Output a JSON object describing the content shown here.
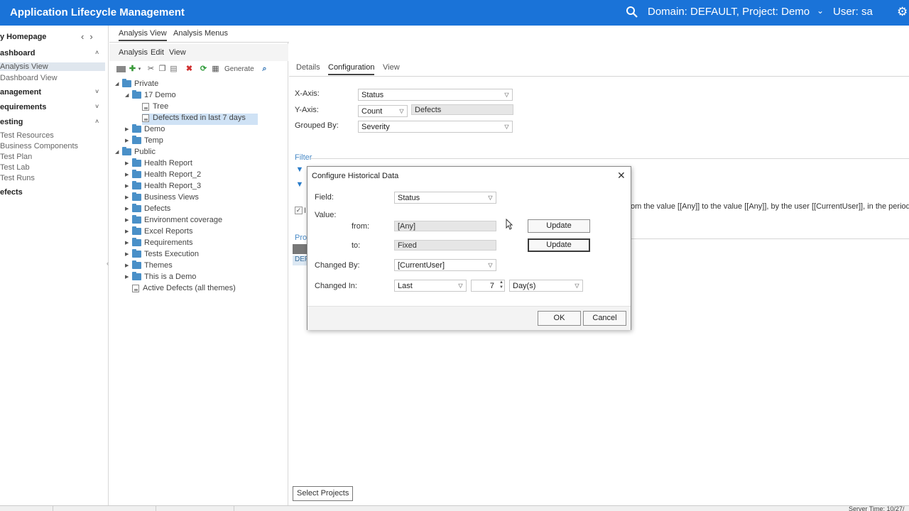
{
  "header": {
    "title": "Application Lifecycle Management",
    "domain_project": "Domain: DEFAULT, Project: Demo",
    "user": "User: sa",
    "colors": {
      "brand": "#1a73d8"
    }
  },
  "nav": {
    "home": "y Homepage",
    "sections": [
      {
        "label": "ashboard",
        "items": [
          "Analysis View",
          "Dashboard View"
        ]
      },
      {
        "label": "anagement",
        "items": []
      },
      {
        "label": "equirements",
        "items": []
      },
      {
        "label": "esting",
        "items": [
          "Test Resources",
          "Business Components",
          "Test Plan",
          "Test Lab",
          "Test Runs"
        ]
      },
      {
        "label": "efects",
        "items": []
      }
    ]
  },
  "mid": {
    "tabs": [
      "Analysis View",
      "Analysis Menus"
    ],
    "menu": [
      "Analysis",
      "Edit",
      "View"
    ],
    "generate_label": "Generate",
    "tree": [
      "Private",
      "17 Demo",
      "Tree",
      "Defects fixed in last 7 days",
      "Demo",
      "Temp",
      "Public",
      "Health Report",
      "Health Report_2",
      "Health Report_3",
      "Business Views",
      "Defects",
      "Environment coverage",
      "Excel Reports",
      "Requirements",
      "Tests Execution",
      "Themes",
      "This is a Demo",
      "Active Defects (all themes)"
    ]
  },
  "right": {
    "tabs": [
      "Details",
      "Configuration",
      "View"
    ],
    "x_axis_label": "X-Axis:",
    "x_axis_value": "Status",
    "y_axis_label": "Y-Axis:",
    "y_axis_func": "Count",
    "y_axis_entity": "Defects",
    "grouped_by_label": "Grouped By:",
    "grouped_by_value": "Severity",
    "filter_label": "Filter",
    "desc_text": "om the value [[Any]] to the value [[Any]], by the user [[CurrentUser]], in the period from",
    "pro_label": "Pro",
    "def_cell": "DEF",
    "select_projects": "Select Projects"
  },
  "dialog": {
    "title": "Configure Historical Data",
    "field_label": "Field:",
    "field_value": "Status",
    "value_label": "Value:",
    "from_label": "from:",
    "from_value": "[Any]",
    "to_label": "to:",
    "to_value": "Fixed",
    "update_label": "Update",
    "changed_by_label": "Changed By:",
    "changed_by_value": "[CurrentUser]",
    "changed_in_label": "Changed In:",
    "changed_in_mode": "Last",
    "changed_in_count": "7",
    "changed_in_unit": "Day(s)",
    "ok": "OK",
    "cancel": "Cancel"
  },
  "status": {
    "server_time": "Server Time: 10/27/"
  }
}
